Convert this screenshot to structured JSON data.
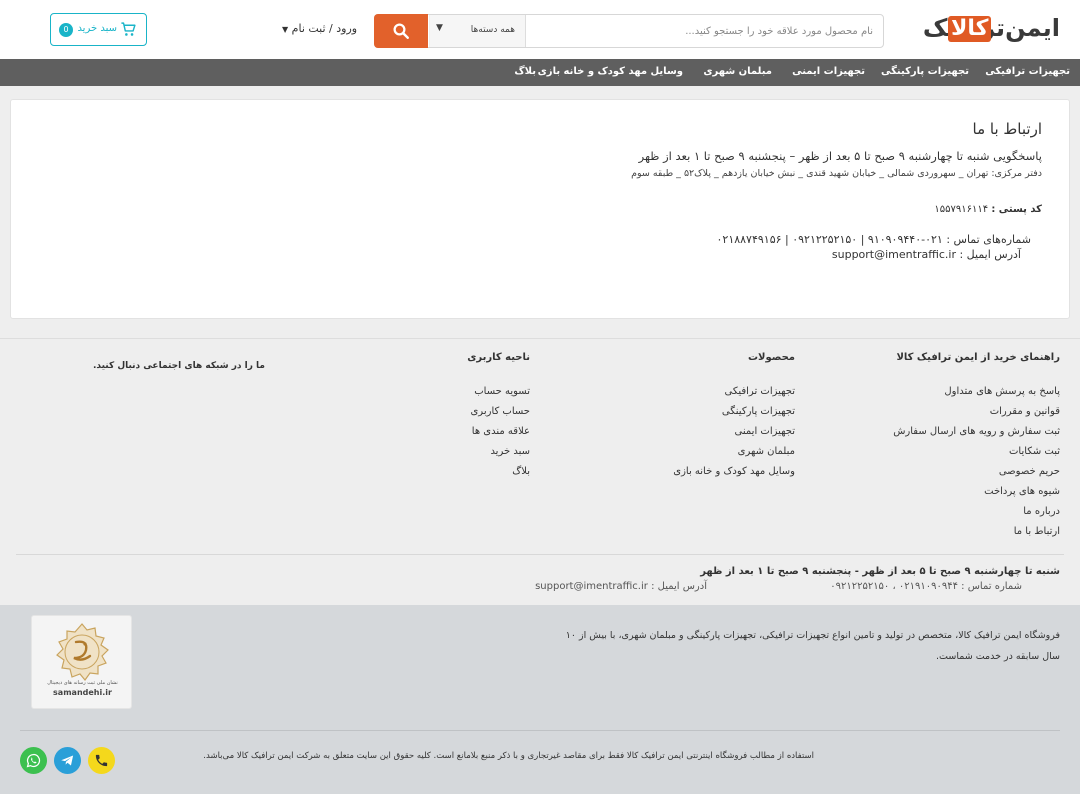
{
  "header": {
    "logo_text_dark": "ایمن‌ترافیک",
    "logo_text_accent": "کالا",
    "search_placeholder": "نام محصول مورد علاقه خود را جستجو کنید...",
    "search_category": "همه دسته‌ها",
    "login_label": "ورود / ثبت نام",
    "cart_label": "سبد خرید",
    "cart_count": "0"
  },
  "nav": {
    "items": [
      "تجهیزات ترافیکی",
      "تجهیزات پارکینگی",
      "تجهیزات ایمنی",
      "مبلمان شهری",
      "وسایل مهد کودک و خانه بازی",
      "بلاگ"
    ]
  },
  "contact": {
    "title": "ارتباط با ما",
    "hours": "پاسخگویی شنبه تا چهارشنبه ۹ صبح تا ۵ بعد از ظهر – پنجشنبه ۹ صبح تا ۱ بعد از ظهر",
    "address": "دفتر مرکزی: تهران _ سهروردی شمالی _ خیابان شهید قندی _ نبش خیابان یازدهم _ پلاک۵۲ _ طبقه سوم",
    "postal_label": "کد پستی :",
    "postal_value": "۱۵۵۷۹۱۶۱۱۴",
    "phones": "شماره‌های تماس : ۰۲۱-۹۱۰۹۰۹۴۴۰ | ۰۹۲۱۲۲۵۲۱۵۰ | ۰۲۱۸۸۷۴۹۱۵۶",
    "email": "آدرس ایمیل : support@imentraffic.ir"
  },
  "footer": {
    "col1_title": "راهنمای خرید از ایمن ترافیک کالا",
    "col1_links": [
      "پاسخ به پرسش های متداول",
      "قوانین و مقررات",
      "ثبت سفارش و رویه های ارسال سفارش",
      "ثبت شکایات",
      "حریم خصوصی",
      "شیوه های پرداخت",
      "درباره ما",
      "ارتباط با ما"
    ],
    "col2_title": "محصولات",
    "col2_links": [
      "تجهیزات ترافیکی",
      "تجهیزات پارکینگی",
      "تجهیزات ایمنی",
      "مبلمان شهری",
      "وسایل مهد کودک و خانه بازی"
    ],
    "col3_title": "ناحیه کاربری",
    "col3_links": [
      "تسویه حساب",
      "حساب کاربری",
      "علاقه مندی ها",
      "سبد خرید",
      "بلاگ"
    ],
    "col4_title": "ما را در شبکه های اجتماعی دنبال کنید.",
    "hours": "شنبه تا چهارشنبه ۹ صبح تا ۵ بعد از ظهر - پنجشنبه ۹ صبح تا ۱ بعد از ظهر",
    "phones": "شماره تماس : ۰۲۱۹۱۰۹۰۹۴۴ ، ۰۹۲۱۲۲۵۲۱۵۰",
    "email": "آدرس ایمیل : support@imentraffic.ir",
    "about": "فروشگاه ایمن ترافیک کالا، متخصص در تولید و تامین انواع تجهیزات ترافیکی، تجهیزات پارکینگی و مبلمان شهری، با بیش از ۱۰ سال سابقه در خدمت شماست.",
    "samandehi_caption": "نشان ملی ثبت رسانه های دیجیتال",
    "samandehi_url": "samandehi.ir",
    "copyright": "استفاده از مطالب فروشگاه اینترنتی ایمن ترافیک کالا فقط برای مقاصد غیرتجاری و با ذکر منبع بلامانع است. کلیه حقوق این سایت متعلق به شرکت ایمن ترافیک کالا می‌باشد."
  },
  "colors": {
    "accent_orange": "#e2612b",
    "accent_cyan": "#19b4c8",
    "nav_bg": "#5f5f5f",
    "whatsapp": "#3cc04f",
    "telegram": "#2a9fd8",
    "phone": "#f4d81c"
  }
}
